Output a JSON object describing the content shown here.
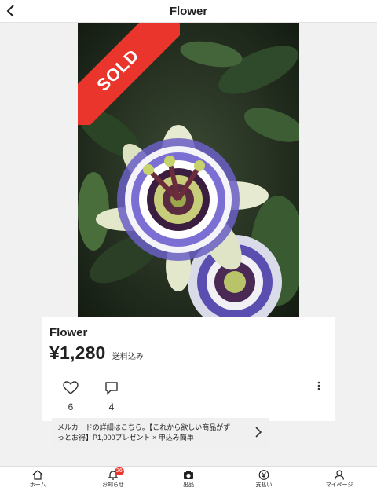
{
  "header": {
    "title": "Flower"
  },
  "photo": {
    "sold_label": "SOLD"
  },
  "item": {
    "name": "Flower",
    "price": "¥1,280",
    "shipping": "送料込み",
    "likes": "6",
    "comments": "4"
  },
  "promo": {
    "text": "メルカードの詳細はこちら。【これから欲しい商品がずーーっとお得】P1,000プレゼント × 申込み簡単"
  },
  "tabbar": {
    "tabs": [
      {
        "label": "ホーム",
        "icon": "home-icon"
      },
      {
        "label": "お知らせ",
        "icon": "bell-icon",
        "badge": "26"
      },
      {
        "label": "出品",
        "icon": "camera-icon"
      },
      {
        "label": "支払い",
        "icon": "yen-icon"
      },
      {
        "label": "マイページ",
        "icon": "person-icon"
      }
    ]
  },
  "colors": {
    "sold_red": "#ea352d",
    "badge_red": "#ea352d"
  }
}
